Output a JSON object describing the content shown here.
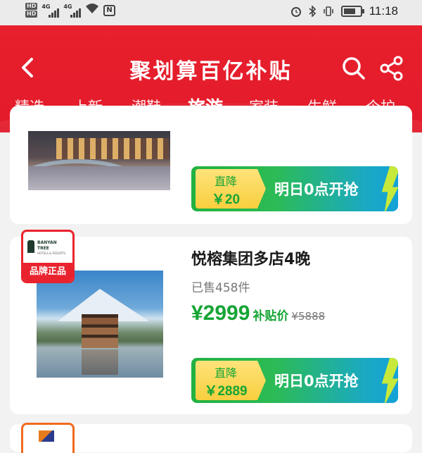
{
  "status_bar": {
    "hd_labels": [
      "HD",
      "HD"
    ],
    "signal_labels": [
      "4G",
      "4G"
    ],
    "time": "11:18"
  },
  "header": {
    "title": "聚划算百亿补贴",
    "back_icon": "chevron-left-icon",
    "search_icon": "search-icon",
    "share_icon": "share-icon",
    "tabs": [
      {
        "label": "精选",
        "active": false
      },
      {
        "label": "上新",
        "active": false
      },
      {
        "label": "潮鞋",
        "active": false
      },
      {
        "label": "旅游",
        "active": true
      },
      {
        "label": "家装",
        "active": false
      },
      {
        "label": "生鲜",
        "active": false
      },
      {
        "label": "个护",
        "active": false
      }
    ]
  },
  "products": [
    {
      "cta": {
        "label": "直降",
        "amount": "￥20",
        "text": "明日0点开抢"
      }
    },
    {
      "badge": {
        "brand": "BANYAN TREE",
        "brand_sub": "HOTELS & RESORTS",
        "label": "品牌正品"
      },
      "title": "悦榕集团多店4晚",
      "sold": "已售458件",
      "price": "¥2999",
      "price_tag": "补贴价",
      "original_price": "¥5888",
      "cta": {
        "label": "直降",
        "amount": "￥2889",
        "text": "明日0点开抢"
      }
    }
  ],
  "colors": {
    "header_red": "#e21a2a",
    "price_green": "#16a535",
    "cta_yellow": "#f8cf3e",
    "badge_red": "#e9232e"
  }
}
